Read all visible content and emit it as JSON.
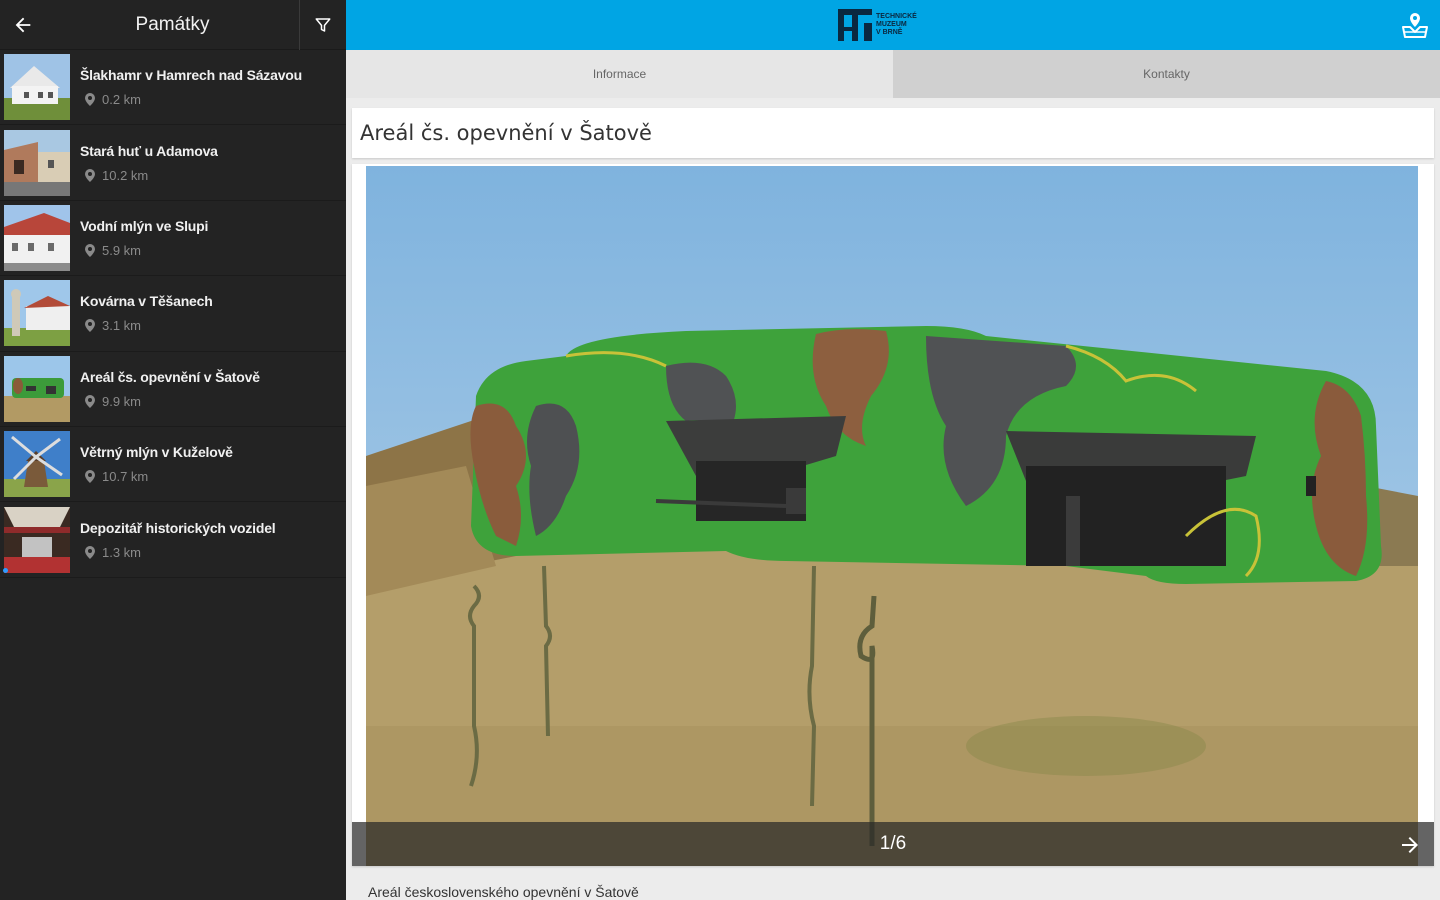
{
  "sidebar": {
    "title": "Památky",
    "items": [
      {
        "name": "Šlakhamr v Hamrech nad Sázavou",
        "distance": "0.2 km"
      },
      {
        "name": "Stará huť u Adamova",
        "distance": "10.2 km"
      },
      {
        "name": "Vodní mlýn ve Slupi",
        "distance": "5.9 km"
      },
      {
        "name": "Kovárna v Těšanech",
        "distance": "3.1 km"
      },
      {
        "name": "Areál čs. opevnění v Šatově",
        "distance": "9.9 km"
      },
      {
        "name": "Větrný mlýn v Kuželově",
        "distance": "10.7 km"
      },
      {
        "name": "Depozitář historických vozidel",
        "distance": "1.3 km"
      }
    ]
  },
  "header": {
    "logo_lines": [
      "TECHNICKÉ",
      "MUZEUM",
      "V BRNĚ"
    ],
    "accent": "#00a5e4"
  },
  "tabs": [
    {
      "label": "Informace"
    },
    {
      "label": "Kontakty"
    }
  ],
  "detail": {
    "title": "Areál čs. opevnění v Šatově",
    "gallery_counter": "1/6",
    "description_start": "Areál československého opevnění v Šatově"
  }
}
